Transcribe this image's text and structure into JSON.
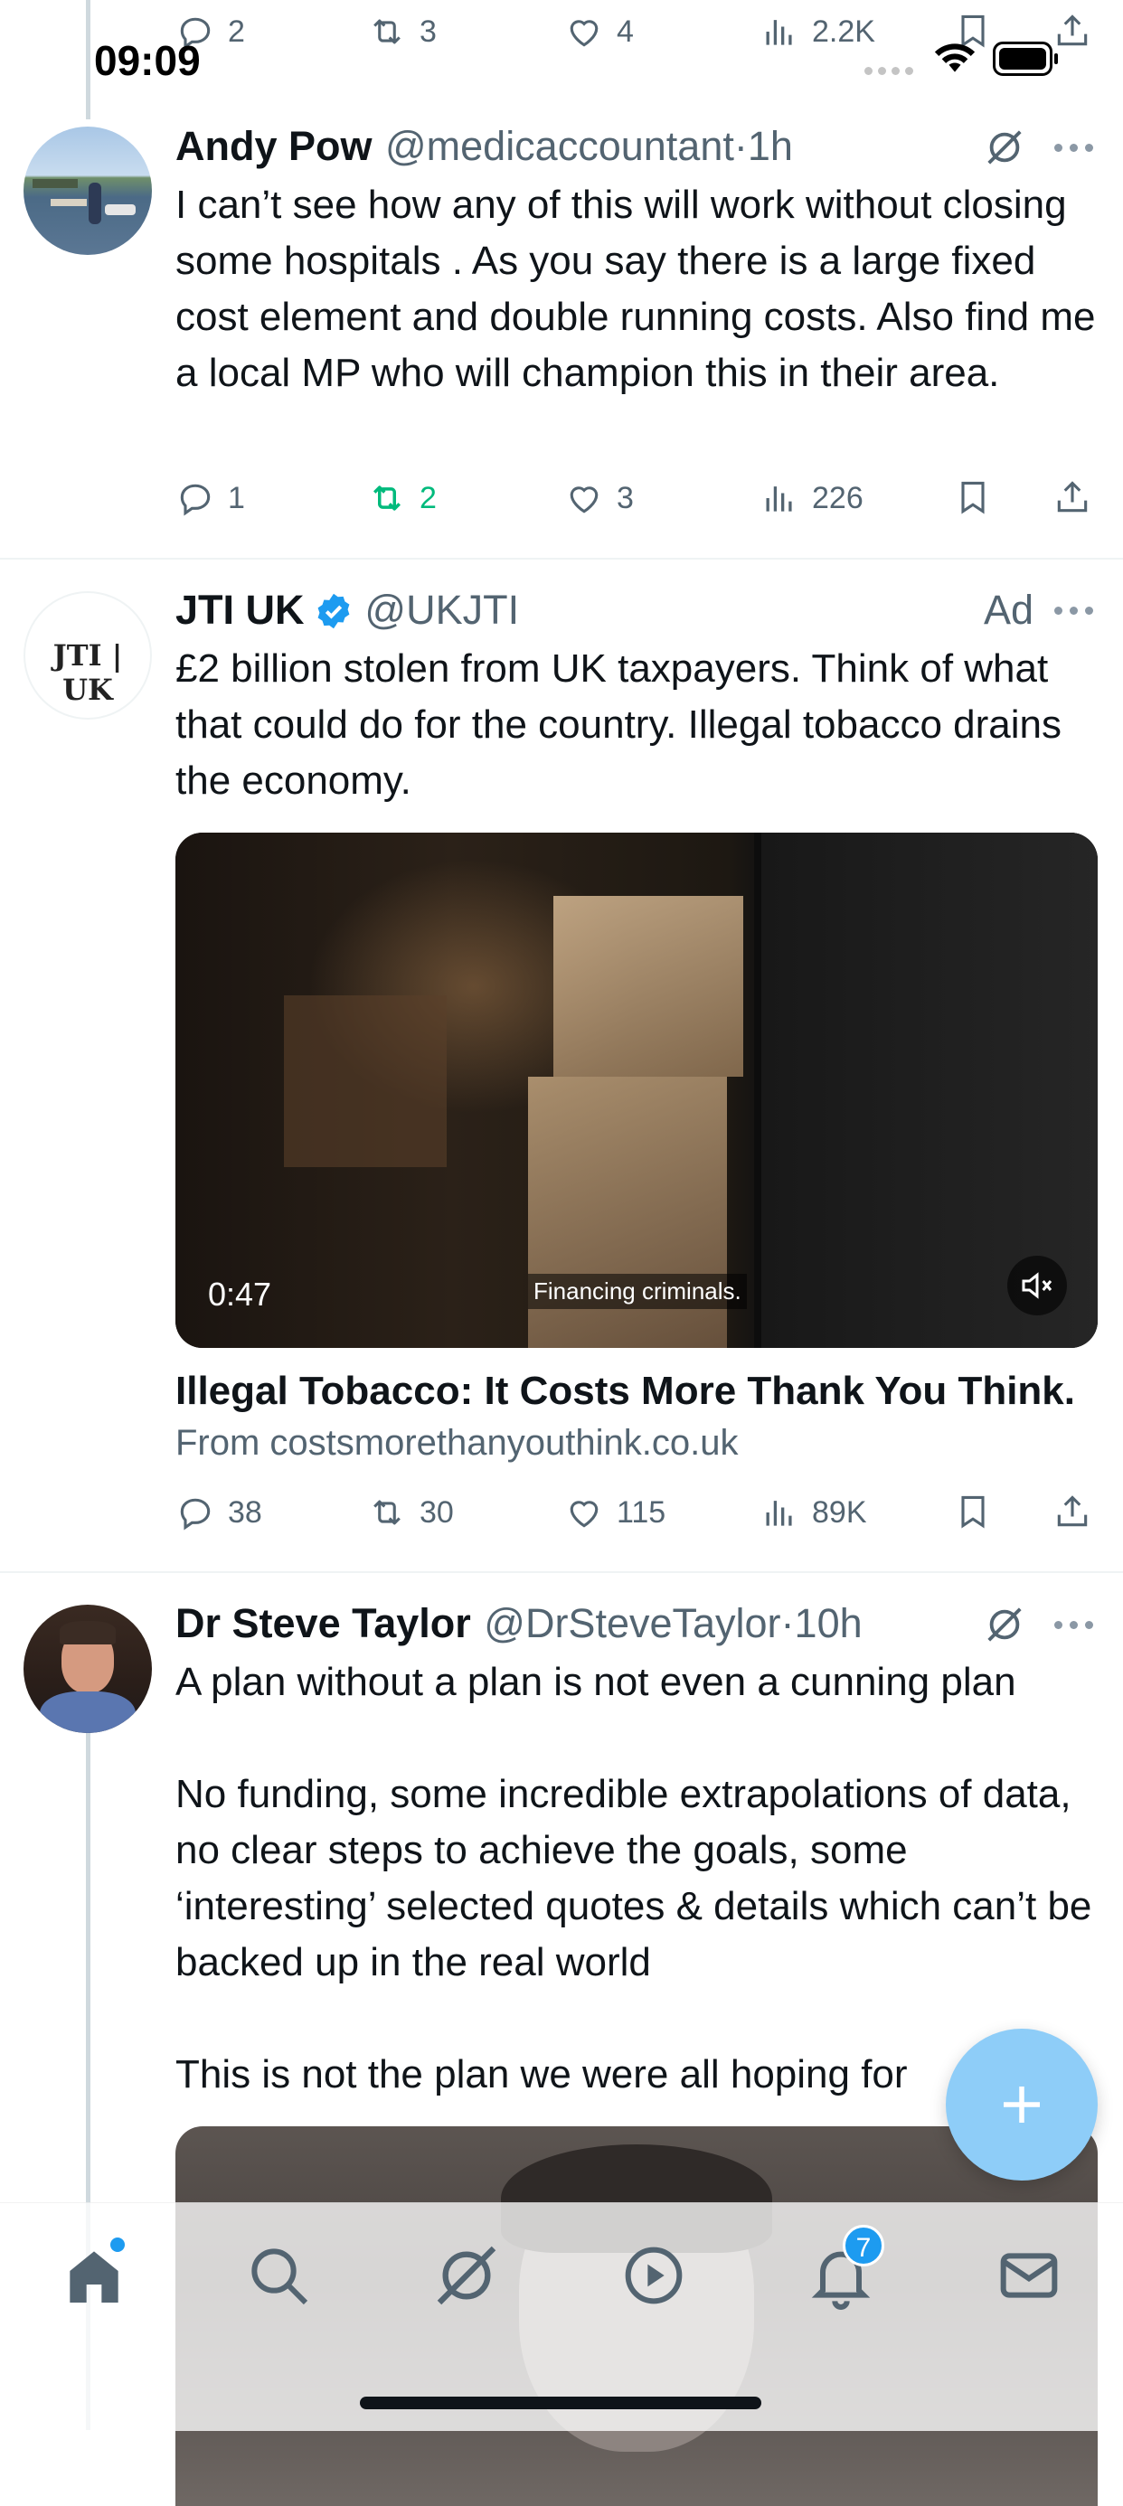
{
  "status_bar": {
    "time": "09:09"
  },
  "prev_tweet_actions": {
    "replies": "2",
    "reposts": "3",
    "likes": "4",
    "views": "2.2K"
  },
  "tweets": [
    {
      "name": "Andy Pow",
      "handle": "@medicaccountant",
      "time": "1h",
      "text": "I can’t see how any of this will work without closing some hospitals . As you say there is a large fixed cost element and double running costs. Also find me a local MP who will champion this in their area.",
      "replies": "1",
      "reposts": "2",
      "likes": "3",
      "views": "226"
    },
    {
      "name": "JTI UK",
      "handle": "@UKJTI",
      "ad_label": "Ad",
      "logo_text": "JTI | UK",
      "text": "£2 billion stolen from UK taxpayers. Think of what that could do for the country. Illegal tobacco drains the economy.",
      "video_duration": "0:47",
      "video_caption": "Financing criminals.",
      "card_title": "Illegal Tobacco: It Costs More Thank You Think.",
      "card_source": "From costsmorethanyouthink.co.uk",
      "replies": "38",
      "reposts": "30",
      "likes": "115",
      "views": "89K"
    },
    {
      "name": "Dr Steve Taylor",
      "handle": "@DrSteveTaylor",
      "time": "10h",
      "text": "A plan without a plan is not even a cunning plan\n\nNo funding, some incredible extrapolations of data, no clear steps to achieve the goals, some ‘interesting’ selected quotes & details which can’t be backed up in the real world\n\nThis is not the plan we were all hoping for"
    }
  ],
  "tab_bar": {
    "notifications_badge": "7"
  },
  "colors": {
    "accent": "#1d9bf0",
    "repost_active": "#00ba7c",
    "secondary_text": "#536471"
  }
}
